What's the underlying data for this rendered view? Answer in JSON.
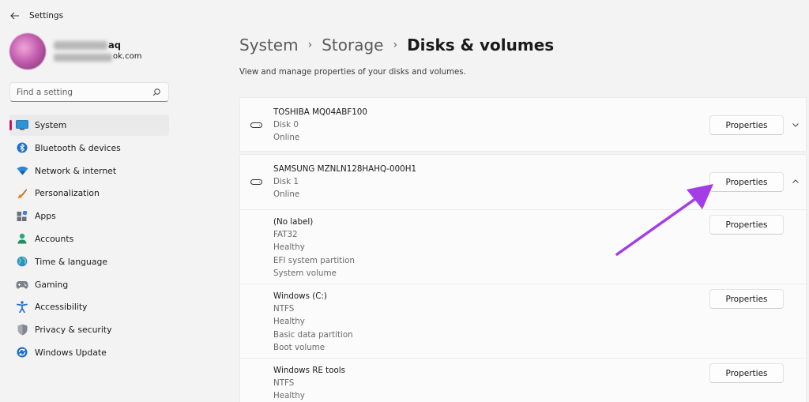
{
  "window": {
    "title": "Settings"
  },
  "profile": {
    "name_suffix": "aq",
    "email_suffix": "ok.com"
  },
  "search": {
    "placeholder": "Find a setting"
  },
  "sidebar": {
    "items": [
      {
        "label": "System",
        "icon": "system-icon",
        "active": true
      },
      {
        "label": "Bluetooth & devices",
        "icon": "bluetooth-icon"
      },
      {
        "label": "Network & internet",
        "icon": "wifi-icon"
      },
      {
        "label": "Personalization",
        "icon": "brush-icon"
      },
      {
        "label": "Apps",
        "icon": "apps-icon"
      },
      {
        "label": "Accounts",
        "icon": "person-icon"
      },
      {
        "label": "Time & language",
        "icon": "globe-icon"
      },
      {
        "label": "Gaming",
        "icon": "gamepad-icon"
      },
      {
        "label": "Accessibility",
        "icon": "accessibility-icon"
      },
      {
        "label": "Privacy & security",
        "icon": "shield-icon"
      },
      {
        "label": "Windows Update",
        "icon": "update-icon"
      }
    ]
  },
  "breadcrumb": {
    "items": [
      "System",
      "Storage",
      "Disks & volumes"
    ],
    "separator": "›"
  },
  "page": {
    "subtitle": "View and manage properties of your disks and volumes."
  },
  "disks": [
    {
      "name": "TOSHIBA MQ04ABF100",
      "disk": "Disk 0",
      "status": "Online",
      "button": "Properties",
      "expanded": false
    },
    {
      "name": "SAMSUNG MZNLN128HAHQ-000H1",
      "disk": "Disk 1",
      "status": "Online",
      "button": "Properties",
      "expanded": true,
      "volumes": [
        {
          "label": "(No label)",
          "details": [
            "FAT32",
            "Healthy",
            "EFI system partition",
            "System volume"
          ],
          "button": "Properties"
        },
        {
          "label": "Windows (C:)",
          "details": [
            "NTFS",
            "Healthy",
            "Basic data partition",
            "Boot volume"
          ],
          "button": "Properties"
        },
        {
          "label": "Windows RE tools",
          "details": [
            "NTFS",
            "Healthy"
          ],
          "button": "Properties"
        }
      ]
    }
  ],
  "colors": {
    "accent": "#c2186b",
    "annotation_arrow": "#a43de6"
  }
}
